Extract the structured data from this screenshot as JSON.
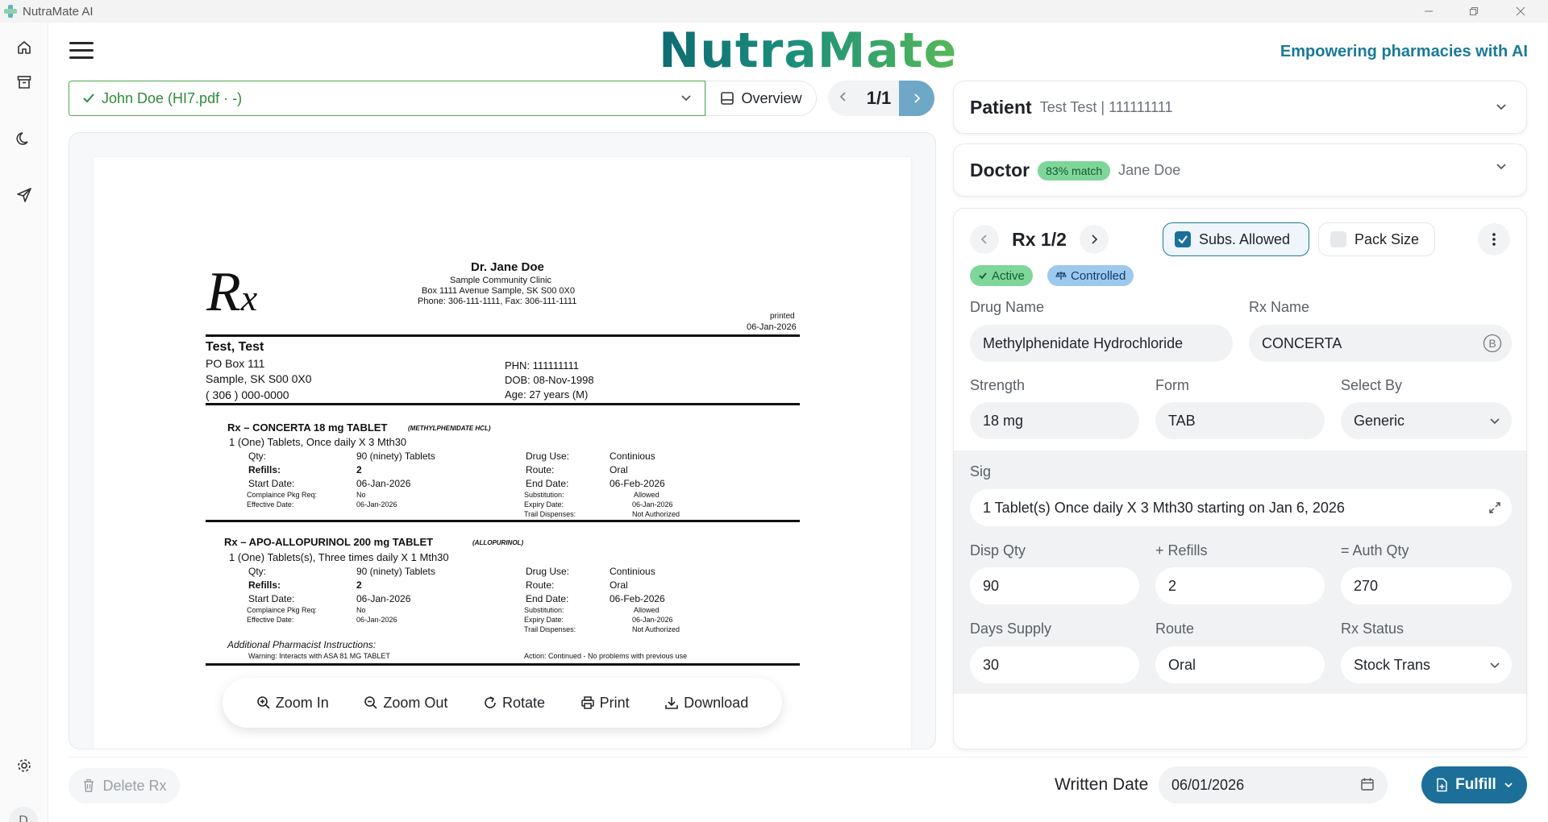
{
  "window": {
    "title": "NutraMate AI"
  },
  "header": {
    "brand": "NutraMate",
    "tagline": "Empowering pharmacies with AI"
  },
  "file_selector": {
    "value": "John Doe (HI7.pdf · -)",
    "overview_label": "Overview",
    "page_indicator": "1/1"
  },
  "document": {
    "doctor_name": "Dr. Jane Doe",
    "clinic": "Sample Community Clinic",
    "clinic_address": "Box 1111 Avenue Sample, SK S00 0X0",
    "clinic_phone": "Phone: 306-111-1111, Fax: 306-111-1111",
    "printed_label": "printed",
    "printed_date": "06-Jan-2026",
    "patient_name": "Test, Test",
    "patient_addr1": "PO Box 111",
    "patient_addr2": "Sample, SK S00 0X0",
    "patient_phone": "( 306 ) 000-0000",
    "phn": "PHN: 111111111",
    "dob": "DOB: 08-Nov-1998",
    "age": "Age: 27 years (M)",
    "rx": [
      {
        "title": "Rx – CONCERTA 18 mg TABLET",
        "generic": "(METHYLPHENIDATE HCL)",
        "sig": "1 (One) Tablets, Once daily X 3 Mth30",
        "qty_label": "Qty:",
        "qty": "90 (ninety) Tablets",
        "refills_label": "Refills:",
        "refills": "2",
        "start_label": "Start Date:",
        "start": "06-Jan-2026",
        "comp_label": "Complaince Pkg Req:",
        "comp": "No",
        "eff_label": "Effective Date:",
        "eff": "06-Jan-2026",
        "use_label": "Drug Use:",
        "use": "Continious",
        "route_label": "Route:",
        "route": "Oral",
        "end_label": "End Date:",
        "end": "06-Feb-2026",
        "subs_label": "Substitution:",
        "subs": "Allowed",
        "exp_label": "Expiry Date:",
        "exp": "06-Jan-2026",
        "trail_label": "Trail Dispenses:",
        "trail": "Not Authorized"
      },
      {
        "title": "Rx – APO-ALLOPURINOL 200 mg TABLET",
        "generic": "(ALLOPURINOL)",
        "sig": "1 (One) Tablets(s), Three times daily X 1 Mth30",
        "qty_label": "Qty:",
        "qty": "90 (ninety) Tablets",
        "refills_label": "Refills:",
        "refills": "2",
        "start_label": "Start Date:",
        "start": "06-Jan-2026",
        "comp_label": "Complaince Pkg Req:",
        "comp": "No",
        "eff_label": "Effective Date:",
        "eff": "06-Jan-2026",
        "use_label": "Drug Use:",
        "use": "Continious",
        "route_label": "Route:",
        "route": "Oral",
        "end_label": "End Date:",
        "end": "06-Feb-2026",
        "subs_label": "Substitution:",
        "subs": "Allowed",
        "exp_label": "Expiry Date:",
        "exp": "06-Jan-2026",
        "trail_label": "Trail Dispenses:",
        "trail": "Not Authorized"
      }
    ],
    "additional_title": "Additional Pharmacist Instructions:",
    "warning": "Warning: Interacts with ASA 81 MG TABLET",
    "action": "Action: Continued - No problems with previous use"
  },
  "viewer_toolbar": {
    "zoom_in": "Zoom In",
    "zoom_out": "Zoom Out",
    "rotate": "Rotate",
    "print": "Print",
    "download": "Download"
  },
  "patient": {
    "title": "Patient",
    "summary": "Test Test | 111111111"
  },
  "doctor": {
    "title": "Doctor",
    "match": "83% match",
    "name": "Jane Doe"
  },
  "rx_panel": {
    "nav_label": "Rx 1/2",
    "subs_allowed": {
      "label": "Subs. Allowed",
      "checked": true
    },
    "pack_size": {
      "label": "Pack Size",
      "checked": false
    },
    "badges": {
      "active": "Active",
      "controlled": "Controlled"
    },
    "fields": {
      "drug_name": {
        "label": "Drug Name",
        "value": "Methylphenidate Hydrochloride"
      },
      "rx_name": {
        "label": "Rx Name",
        "value": "CONCERTA",
        "suffix": "B"
      },
      "strength": {
        "label": "Strength",
        "value": "18 mg"
      },
      "form": {
        "label": "Form",
        "value": "TAB"
      },
      "select_by": {
        "label": "Select By",
        "value": "Generic"
      },
      "sig": {
        "label": "Sig",
        "value": "1 Tablet(s) Once daily X 3 Mth30 starting on Jan 6, 2026"
      },
      "disp_qty": {
        "label": "Disp Qty",
        "value": "90"
      },
      "refills": {
        "label": "+ Refills",
        "value": "2"
      },
      "auth_qty": {
        "label": "= Auth Qty",
        "value": "270"
      },
      "days_supply": {
        "label": "Days Supply",
        "value": "30"
      },
      "route": {
        "label": "Route",
        "value": "Oral"
      },
      "rx_status": {
        "label": "Rx Status",
        "value": "Stock Trans"
      }
    }
  },
  "footer": {
    "delete_label": "Delete Rx",
    "written_date_label": "Written Date",
    "written_date_value": "06/01/2026",
    "fulfill_label": "Fulfill"
  },
  "user": {
    "avatar_initial": "D"
  },
  "colors": {
    "accent": "#1c6f98",
    "success": "#4cae4c",
    "brand_teal": "#1b7a96"
  }
}
